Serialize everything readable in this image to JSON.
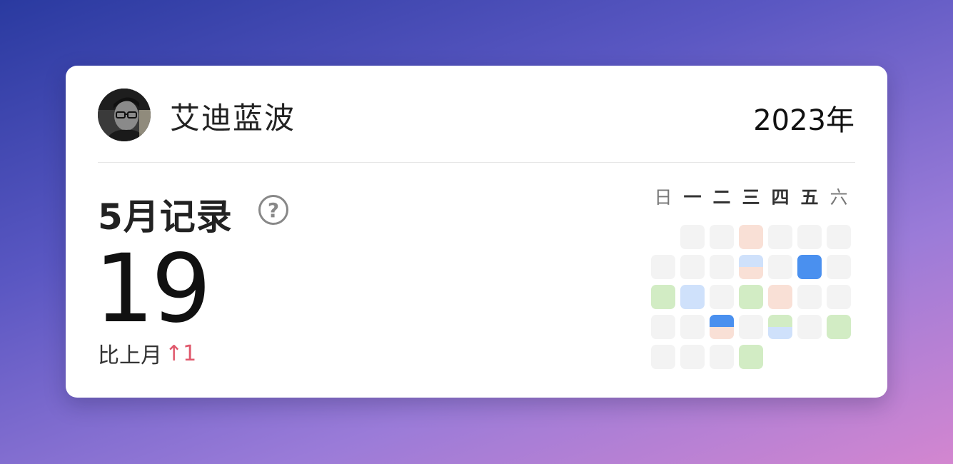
{
  "user": {
    "name": "艾迪蓝波"
  },
  "header": {
    "year": "2023年"
  },
  "summary": {
    "title": "5月记录",
    "help_symbol": "?",
    "count": "19",
    "compare_label": "比上月",
    "compare_arrow": "↑",
    "compare_delta": "1"
  },
  "colors": {
    "empty": "#f3f3f3",
    "peach": "#f9e0d6",
    "light_blue": "#cfe1fb",
    "blue": "#4a90ef",
    "green": "#d2ecc4",
    "accent_red": "#e0586c"
  },
  "calendar": {
    "weekdays": [
      "日",
      "一",
      "二",
      "三",
      "四",
      "五",
      "六"
    ],
    "weeks": [
      [
        null,
        [
          "empty"
        ],
        [
          "empty"
        ],
        [
          "peach"
        ],
        [
          "empty"
        ],
        [
          "empty"
        ],
        [
          "empty"
        ]
      ],
      [
        [
          "empty"
        ],
        [
          "empty"
        ],
        [
          "empty"
        ],
        [
          "light_blue",
          "peach"
        ],
        [
          "empty"
        ],
        [
          "blue"
        ],
        [
          "empty"
        ]
      ],
      [
        [
          "green"
        ],
        [
          "light_blue"
        ],
        [
          "empty"
        ],
        [
          "green"
        ],
        [
          "peach"
        ],
        [
          "empty"
        ],
        [
          "empty"
        ]
      ],
      [
        [
          "empty"
        ],
        [
          "empty"
        ],
        [
          "blue",
          "peach"
        ],
        [
          "empty"
        ],
        [
          "green",
          "light_blue"
        ],
        [
          "empty"
        ],
        [
          "green"
        ]
      ],
      [
        [
          "empty"
        ],
        [
          "empty"
        ],
        [
          "empty"
        ],
        [
          "green"
        ],
        null,
        null,
        null
      ]
    ]
  }
}
